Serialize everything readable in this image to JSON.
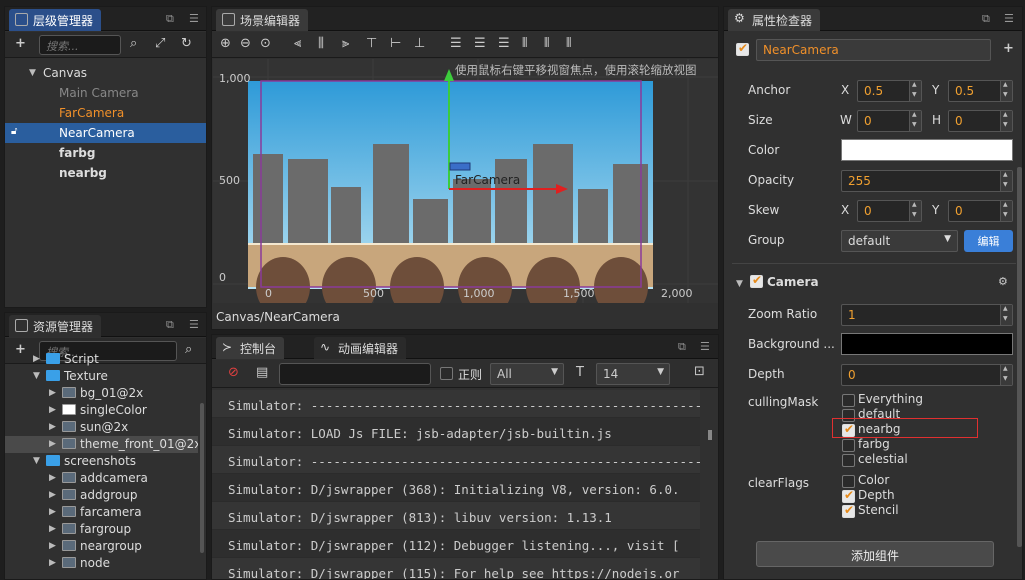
{
  "hierarchy": {
    "tab": "层级管理器",
    "search_placeholder": "搜索...",
    "canvas": "Canvas",
    "items": [
      "Main Camera",
      "FarCamera",
      "NearCamera",
      "farbg",
      "nearbg"
    ]
  },
  "assets": {
    "tab": "资源管理器",
    "search_placeholder": "搜索...",
    "rows": [
      "Script",
      "Texture",
      "bg_01@2x",
      "singleColor",
      "sun@2x",
      "theme_front_01@2x",
      "screenshots",
      "addcamera",
      "addgroup",
      "farcamera",
      "fargroup",
      "neargroup",
      "node"
    ]
  },
  "scene": {
    "tab": "场景编辑器",
    "hint": "使用鼠标右键平移视窗焦点，使用滚轮缩放视图",
    "y_labels": [
      "1,000",
      "500",
      "0"
    ],
    "x_labels": [
      "0",
      "500",
      "1,000",
      "1,500",
      "2,000"
    ],
    "node_label": "FarCamera",
    "breadcrumb": "Canvas/NearCamera"
  },
  "console": {
    "tabs": [
      "控制台",
      "动画编辑器"
    ],
    "regex_label": "正则",
    "level": "All",
    "font_size": "14",
    "lines": [
      "Simulator: --------------------------------------------------------",
      "Simulator: LOAD Js FILE: jsb-adapter/jsb-builtin.js",
      "Simulator: --------------------------------------------------------",
      "Simulator: D/jswrapper (368): Initializing V8, version: 6.0.",
      "Simulator: D/jswrapper (813): libuv version: 1.13.1",
      "Simulator: D/jswrapper (112): Debugger listening..., visit [",
      "Simulator: D/jswrapper (115): For help see https://nodejs.or"
    ]
  },
  "inspector": {
    "tab": "属性检查器",
    "node_name": "NearCamera",
    "anchor": {
      "label": "Anchor",
      "x": "0.5",
      "y": "0.5"
    },
    "size": {
      "label": "Size",
      "w": "0",
      "h": "0"
    },
    "color": {
      "label": "Color",
      "value": "#ffffff"
    },
    "opacity": {
      "label": "Opacity",
      "value": "255"
    },
    "skew": {
      "label": "Skew",
      "x": "0",
      "y": "0"
    },
    "group": {
      "label": "Group",
      "value": "default",
      "edit": "编辑"
    },
    "camera": {
      "title": "Camera",
      "zoom_ratio": {
        "label": "Zoom Ratio",
        "value": "1"
      },
      "background": {
        "label": "Background ...",
        "value": "#000000"
      },
      "depth": {
        "label": "Depth",
        "value": "0"
      },
      "culling_mask": {
        "label": "cullingMask",
        "options": [
          "Everything",
          "default",
          "nearbg",
          "farbg",
          "celestial"
        ],
        "checked": [
          false,
          false,
          true,
          false,
          false
        ]
      },
      "clear_flags": {
        "label": "clearFlags",
        "options": [
          "Color",
          "Depth",
          "Stencil"
        ],
        "checked": [
          false,
          true,
          true
        ]
      }
    },
    "add_component": "添加组件"
  },
  "axis_labels": {
    "x": "X",
    "y": "Y",
    "w": "W",
    "h": "H"
  }
}
